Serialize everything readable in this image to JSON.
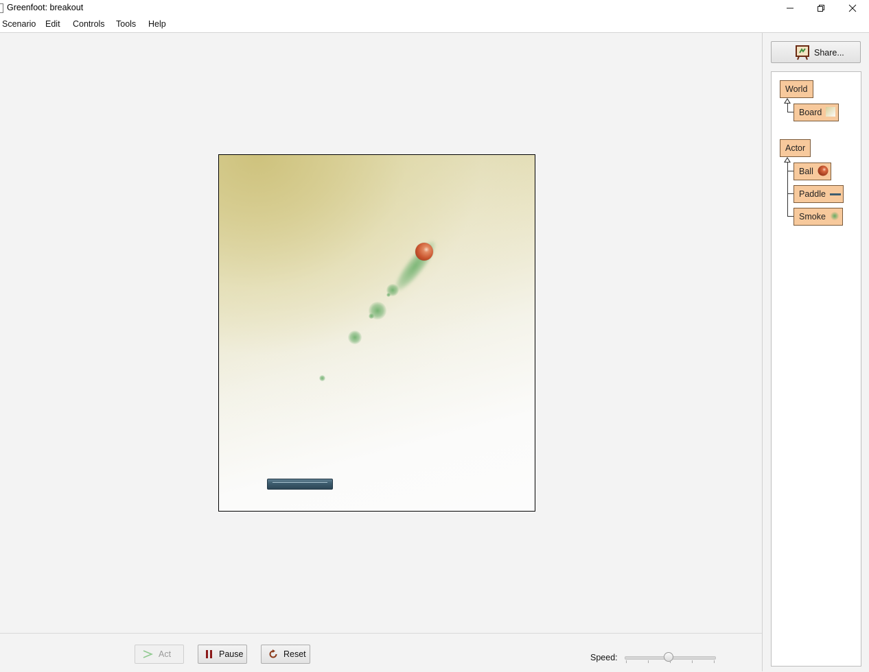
{
  "window": {
    "title": "Greenfoot: breakout",
    "minimize_icon": "minimize-icon",
    "maximize_icon": "restore-icon",
    "close_icon": "close-icon"
  },
  "menu": [
    "Scenario",
    "Edit",
    "Controls",
    "Tools",
    "Help"
  ],
  "world": {
    "background": "Board",
    "actors": [
      "Ball",
      "Paddle",
      "Smoke"
    ]
  },
  "controls": {
    "act_label": "Act",
    "act_enabled": false,
    "pause_label": "Pause",
    "reset_label": "Reset",
    "speed_label": "Speed:",
    "speed_value_fraction": 0.5
  },
  "share": {
    "label": "Share...",
    "icon": "share-easel-icon"
  },
  "classes": {
    "world_root": "World",
    "world_subclasses": [
      {
        "name": "Board",
        "icon": "board-thumbnail"
      }
    ],
    "actor_root": "Actor",
    "actor_subclasses": [
      {
        "name": "Ball",
        "icon": "ball-thumbnail"
      },
      {
        "name": "Paddle",
        "icon": "paddle-thumbnail"
      },
      {
        "name": "Smoke",
        "icon": "smoke-thumbnail"
      }
    ]
  },
  "colors": {
    "class_box": "#f7c99c",
    "paddle": "#3e5d6f",
    "ball": "#c9552f",
    "smoke": "#62aa62"
  }
}
